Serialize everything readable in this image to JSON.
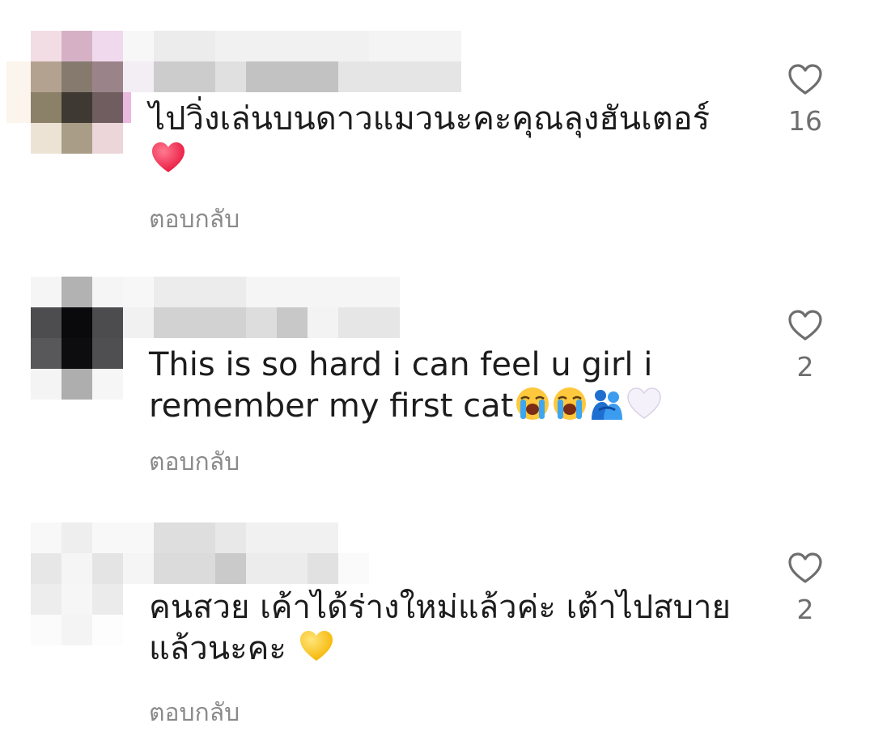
{
  "comments": [
    {
      "text": "ไปวิ่งเล่นบนดาวแมวนะคะคุณลุงฮันเตอร์",
      "emojis": [
        "red-heart"
      ],
      "reply": "ตอบกลับ",
      "likes": "16"
    },
    {
      "text": "This is so hard i can feel u girl i remember my first cat",
      "emojis": [
        "loudly-crying-face",
        "loudly-crying-face",
        "people-hugging",
        "white-heart"
      ],
      "reply": "ตอบกลับ",
      "likes": "2"
    },
    {
      "text": "คนสวย เค้าได้ร่างใหม่แล้วค่ะ เต้าไปสบายแล้วนะคะ",
      "emojis": [
        "yellow-heart"
      ],
      "reply": "ตอบกลับ",
      "likes": "2"
    }
  ],
  "colors": {
    "text": "#1c1c1c",
    "secondary": "#8a8a8a",
    "like_count": "#6e6e6e",
    "heart_outline": "#6e6e6e"
  }
}
